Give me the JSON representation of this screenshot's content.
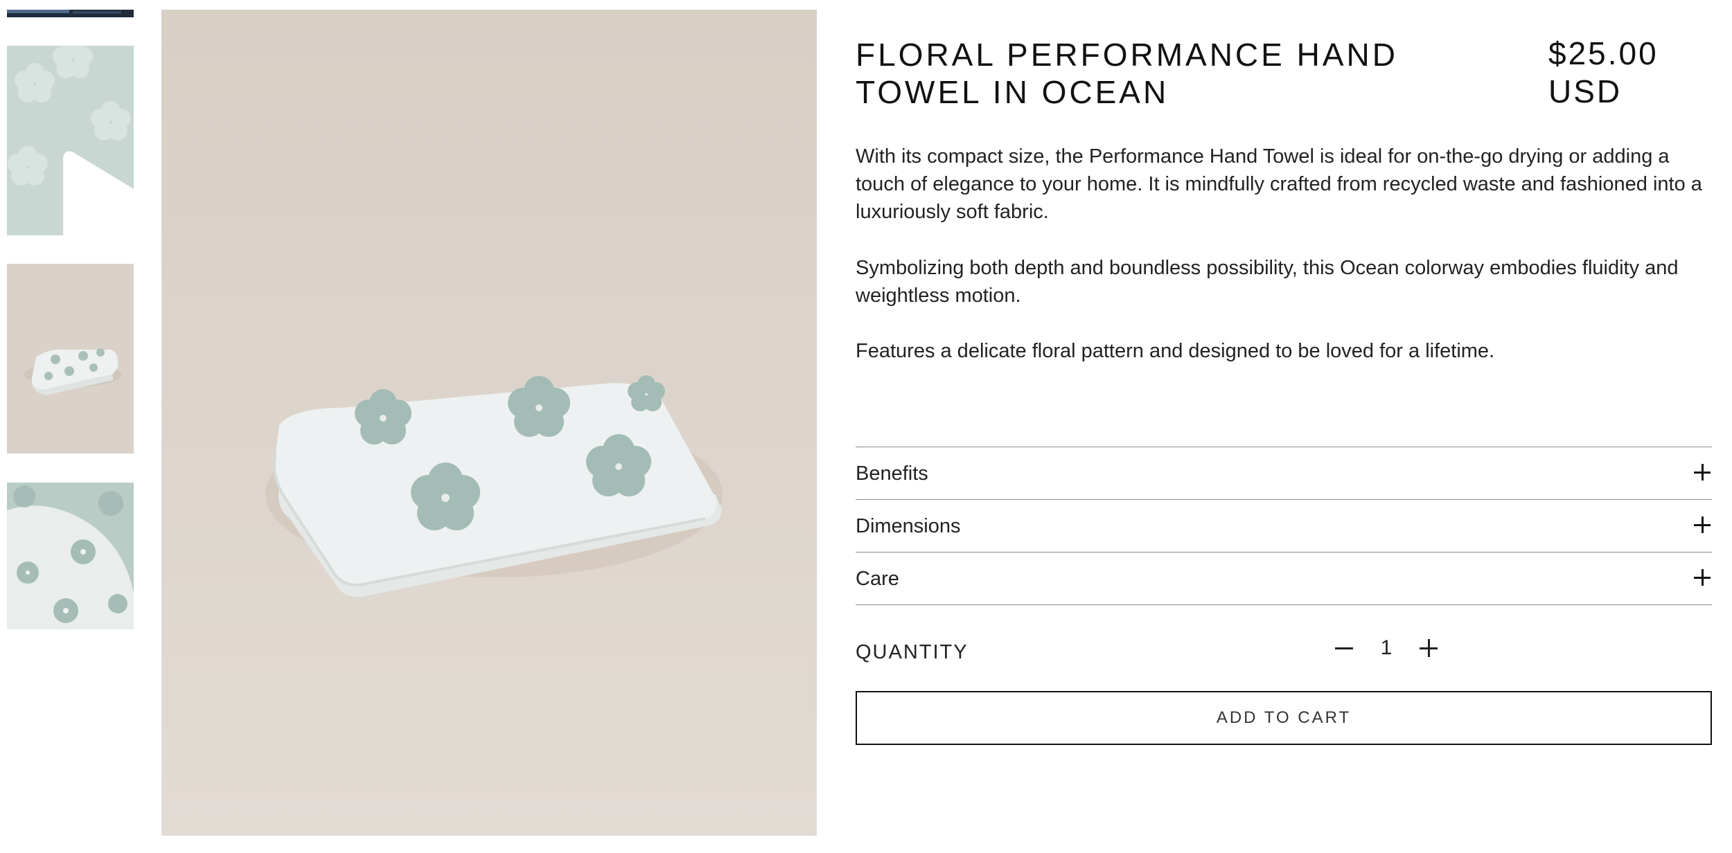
{
  "gallery": {
    "thumbnails": [
      {
        "kind": "image",
        "icon": "ocean-towel-thumbnail"
      },
      {
        "kind": "video",
        "icon": "play-icon"
      },
      {
        "kind": "image",
        "icon": "folded-towel-thumbnail"
      },
      {
        "kind": "image",
        "icon": "towel-closeup-thumbnail"
      }
    ],
    "main_image_icon": "folded-towel-photo"
  },
  "product": {
    "title": "FLORAL PERFORMANCE HAND TOWEL IN OCEAN",
    "price": "$25.00 USD",
    "description": [
      "With its compact size, the Performance Hand Towel is ideal for on-the-go drying or adding a touch of elegance to your home. It is mindfully crafted from recycled waste and fashioned into a luxuriously soft fabric.",
      "Symbolizing both depth and boundless possibility, this Ocean colorway embodies fluidity and weightless motion.",
      "Features a delicate floral pattern and designed to be loved for a lifetime."
    ]
  },
  "accordion": [
    {
      "label": "Benefits",
      "icon": "plus-icon"
    },
    {
      "label": "Dimensions",
      "icon": "plus-icon"
    },
    {
      "label": "Care",
      "icon": "plus-icon"
    }
  ],
  "quantity": {
    "label": "QUANTITY",
    "value": "1",
    "decrease_icon": "minus-icon",
    "increase_icon": "plus-icon"
  },
  "cart": {
    "button_label": "ADD TO CART"
  },
  "colors": {
    "background_beige": "#d9d1c8",
    "towel_white": "#eef1f1",
    "flower_sage": "#a3bcb5",
    "border": "#111111"
  }
}
